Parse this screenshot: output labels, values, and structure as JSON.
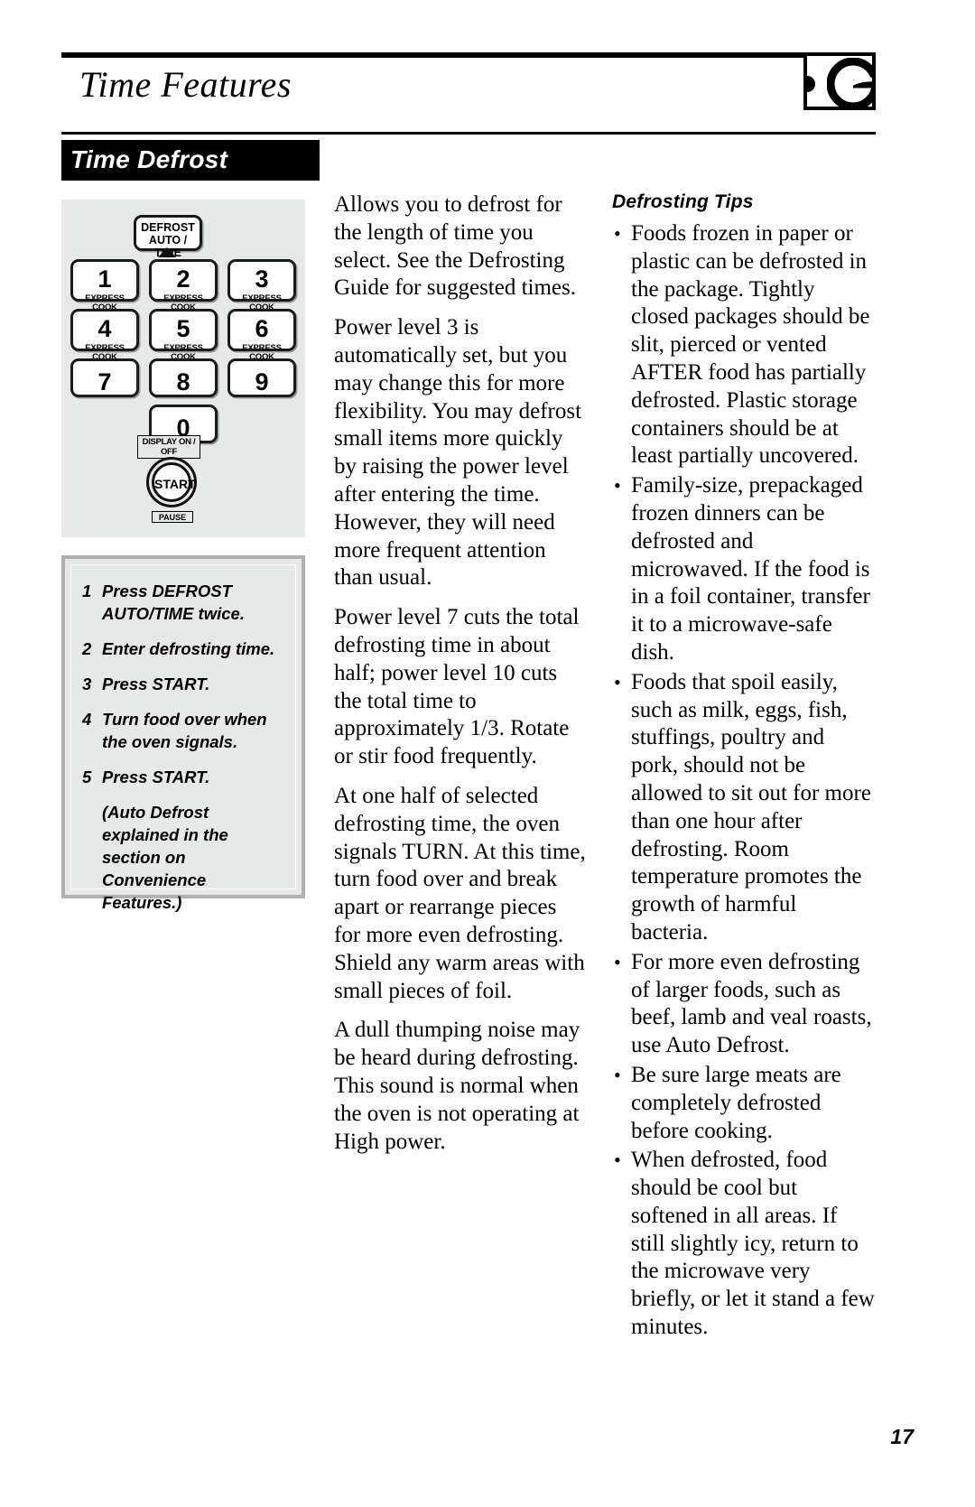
{
  "header": {
    "title": "Time Features",
    "logo_icon": "ge-monogram-icon"
  },
  "section": {
    "band_label": "Time Defrost"
  },
  "keypad": {
    "defrost_key": {
      "line1": "DEFROST",
      "line2": "AUTO / TIME"
    },
    "keys": [
      {
        "num": "1",
        "sub": "EXPRESS COOK"
      },
      {
        "num": "2",
        "sub": "EXPRESS COOK"
      },
      {
        "num": "3",
        "sub": "EXPRESS COOK"
      },
      {
        "num": "4",
        "sub": "EXPRESS COOK"
      },
      {
        "num": "5",
        "sub": "EXPRESS COOK"
      },
      {
        "num": "6",
        "sub": "EXPRESS COOK"
      },
      {
        "num": "7",
        "sub": ""
      },
      {
        "num": "8",
        "sub": ""
      },
      {
        "num": "9",
        "sub": ""
      },
      {
        "num": "0",
        "sub": ""
      }
    ],
    "display_label": "DISPLAY ON / OFF",
    "start_label": "START",
    "pause_label": "PAUSE"
  },
  "steps": [
    {
      "num": "1",
      "text": "Press DEFROST AUTO/TIME twice."
    },
    {
      "num": "2",
      "text": "Enter defrosting time."
    },
    {
      "num": "3",
      "text": "Press START."
    },
    {
      "num": "4",
      "text": "Turn food over when the oven signals."
    },
    {
      "num": "5",
      "text": "Press START."
    }
  ],
  "steps_note": "(Auto Defrost explained in the section on Convenience Features.)",
  "middle_column": {
    "paragraphs": [
      "Allows you to defrost for the length of time you select. See the Defrosting Guide for suggested times.",
      "Power level 3 is automatically set, but you may change this for more flexibility. You may defrost small items more quickly by raising the power level after entering the time. However, they will need more frequent attention than usual.",
      "Power level 7 cuts the total defrosting time in about half; power level 10 cuts the total time to approximately 1/3. Rotate or stir food frequently.",
      "At one half of selected defrosting time, the oven signals TURN. At this time, turn food over and break apart or rearrange pieces for more even defrosting. Shield any warm areas with small pieces of foil.",
      "A dull thumping noise may be heard during defrosting. This sound is normal when the oven is not operating at High power."
    ]
  },
  "right_column": {
    "title": "Defrosting Tips",
    "bullet_glyph": "•",
    "tips": [
      "Foods frozen in paper or plastic can be defrosted in the package. Tightly closed packages should be slit, pierced or vented AFTER food has partially defrosted. Plastic storage containers should be at least partially uncovered.",
      "Family-size, prepackaged frozen dinners can be defrosted and microwaved. If the food is in a foil container, transfer it to a microwave-safe dish.",
      "Foods that spoil easily, such as milk, eggs, fish, stuffings, poultry and pork, should not be allowed to sit out for more than one hour after defrosting. Room temperature promotes the growth of harmful bacteria.",
      "For more even defrosting of larger foods, such as beef, lamb and veal roasts, use Auto Defrost.",
      "Be sure large meats are completely defrosted before cooking.",
      "When defrosted, food should be cool but softened in all areas. If still slightly icy, return to the microwave very briefly, or let it stand a few minutes."
    ]
  },
  "footer": {
    "page_number": "17"
  },
  "colors": {
    "ink": "#000000",
    "panel_gray": "#e7e8e8",
    "box_border_gray": "#b0b0b0"
  }
}
